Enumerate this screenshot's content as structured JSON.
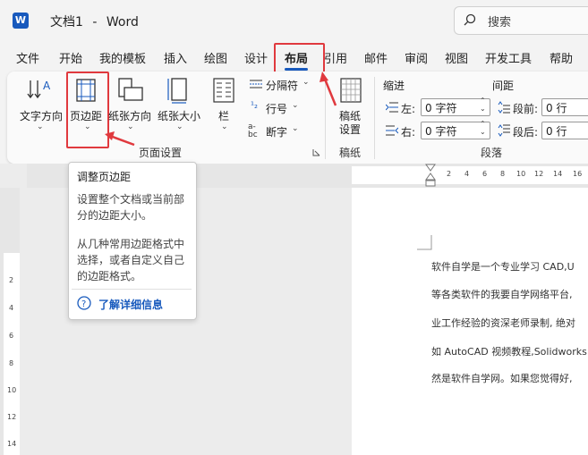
{
  "titlebar": {
    "app_logo": "W",
    "doc_title": "文档1",
    "separator": "-",
    "app_name": "Word",
    "search_placeholder": "搜索"
  },
  "tabs": [
    "文件",
    "开始",
    "我的模板",
    "插入",
    "绘图",
    "设计",
    "布局",
    "引用",
    "邮件",
    "审阅",
    "视图",
    "开发工具",
    "帮助"
  ],
  "active_tab": "布局",
  "ribbon": {
    "page_setup": {
      "text_direction": "文字方向",
      "margins": "页边距",
      "orientation": "纸张方向",
      "size": "纸张大小",
      "columns": "栏",
      "breaks": "分隔符",
      "line_numbers": "行号",
      "hyphenation": "断字",
      "group_label": "页面设置"
    },
    "draft_paper": {
      "button": "稿纸\n设置",
      "button_line1": "稿纸",
      "button_line2": "设置",
      "group_label": "稿纸"
    },
    "paragraph": {
      "indent_header": "缩进",
      "spacing_header": "间距",
      "left_label": "左:",
      "right_label": "右:",
      "left_value": "0 字符",
      "right_value": "0 字符",
      "before_label": "段前:",
      "after_label": "段后:",
      "before_value": "0 行",
      "after_value": "0 行",
      "group_label": "段落"
    }
  },
  "tooltip": {
    "title": "调整页边距",
    "desc1_line1": "设置整个文档或当前部",
    "desc1_line2": "分的边距大小。",
    "desc2_line1": "从几种常用边距格式中",
    "desc2_line2": "选择，或者自定义自己",
    "desc2_line3": "的边距格式。",
    "link": "了解详细信息"
  },
  "ruler": {
    "h_ticks": [
      "2",
      "4",
      "6",
      "8",
      "10",
      "12",
      "14",
      "16"
    ],
    "v_ticks": [
      "2",
      "4",
      "6",
      "8",
      "10",
      "12",
      "14"
    ]
  },
  "document_lines": [
    "软件自学是一个专业学习 CAD,U",
    "等各类软件的我要自学网络平台,",
    "业工作经验的资深老师录制, 绝对",
    "如 AutoCAD 视频教程,Solidworks",
    "然是软件自学网。如果您觉得好,"
  ],
  "colors": {
    "accent": "#185abd",
    "highlight": "#e0393e"
  }
}
